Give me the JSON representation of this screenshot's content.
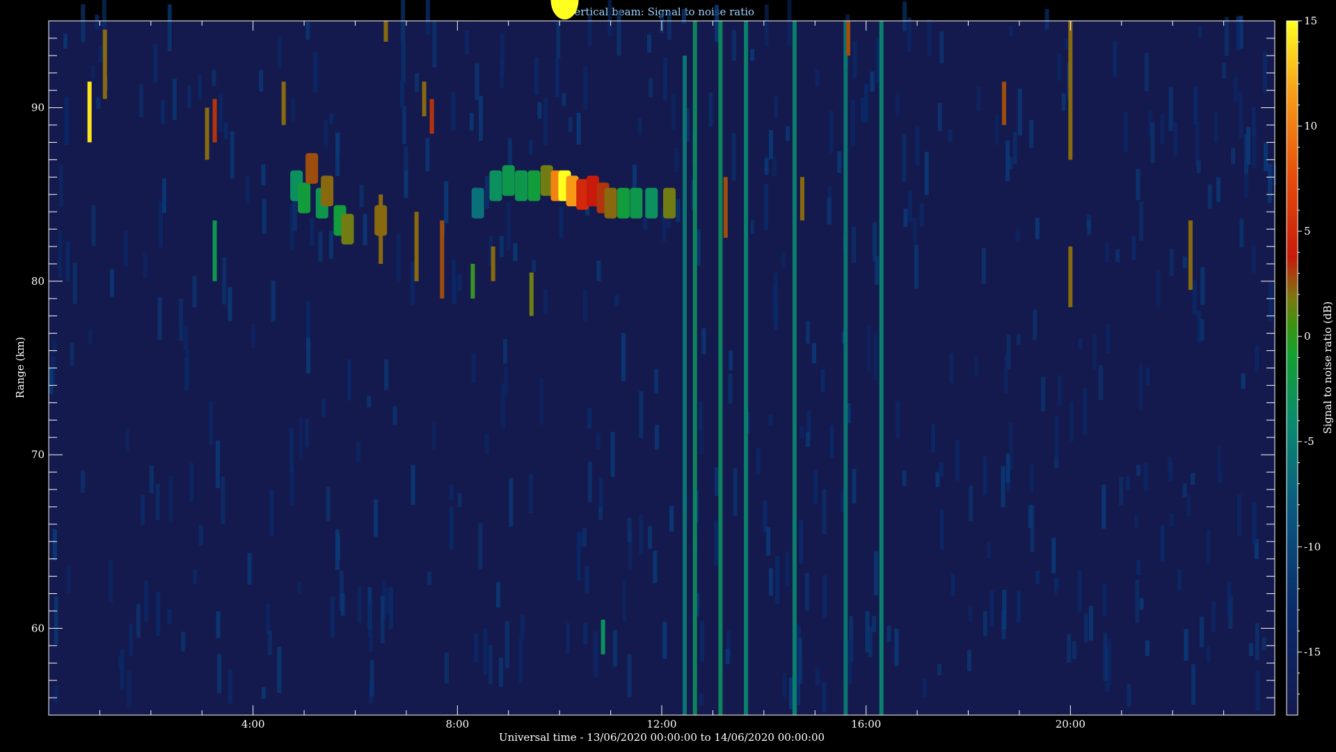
{
  "chart_data": {
    "type": "heatmap",
    "title": "Vertical beam: Signal to noise ratio",
    "xlabel": "Universal time - 13/06/2020 00:00:00 to 14/06/2020 00:00:00",
    "ylabel": "Range (km)",
    "colorbar_label": "Signal to noise ratio (dB)",
    "x_unit": "hours UT",
    "xlim": [
      0,
      24
    ],
    "ylim": [
      55,
      95
    ],
    "x_ticks": [
      {
        "value": 4,
        "label": "4:00"
      },
      {
        "value": 8,
        "label": "8:00"
      },
      {
        "value": 12,
        "label": "12:00"
      },
      {
        "value": 16,
        "label": "16:00"
      },
      {
        "value": 20,
        "label": "20:00"
      }
    ],
    "y_ticks": [
      {
        "value": 60,
        "label": "60"
      },
      {
        "value": 70,
        "label": "70"
      },
      {
        "value": 80,
        "label": "80"
      },
      {
        "value": 90,
        "label": "90"
      }
    ],
    "colorbar_range": [
      -18,
      15
    ],
    "colorbar_ticks": [
      {
        "value": 15,
        "label": "15"
      },
      {
        "value": 10,
        "label": "10"
      },
      {
        "value": 5,
        "label": "5"
      },
      {
        "value": 0,
        "label": "0"
      },
      {
        "value": -5,
        "label": "-5"
      },
      {
        "value": -10,
        "label": "-10"
      },
      {
        "value": -15,
        "label": "-15"
      }
    ],
    "background_snr_db": -16,
    "colormap": [
      "#141a4e",
      "#0a2a6a",
      "#0a5a80",
      "#0a8a70",
      "#14a030",
      "#7a7a10",
      "#c81a0a",
      "#e8500a",
      "#f8a018",
      "#ffff20"
    ],
    "echo_layer": {
      "time_start": 4.8,
      "time_end": 12.2,
      "range_center_km": 85.2,
      "peak": {
        "time": 10.1,
        "range_km": 85.5,
        "snr_db": 15
      },
      "cells": [
        {
          "t": 4.85,
          "r": 85.5,
          "snr": -6
        },
        {
          "t": 5.0,
          "r": 84.8,
          "snr": -4
        },
        {
          "t": 5.15,
          "r": 86.5,
          "snr": 2
        },
        {
          "t": 5.35,
          "r": 84.5,
          "snr": -5
        },
        {
          "t": 5.45,
          "r": 85.2,
          "snr": 1
        },
        {
          "t": 5.7,
          "r": 83.5,
          "snr": -4
        },
        {
          "t": 5.85,
          "r": 83.0,
          "snr": 0
        },
        {
          "t": 6.5,
          "r": 83.5,
          "snr": 1
        },
        {
          "t": 8.4,
          "r": 84.5,
          "snr": -9
        },
        {
          "t": 8.75,
          "r": 85.5,
          "snr": -6
        },
        {
          "t": 9.0,
          "r": 85.8,
          "snr": -5
        },
        {
          "t": 9.25,
          "r": 85.5,
          "snr": -5
        },
        {
          "t": 9.5,
          "r": 85.5,
          "snr": -4
        },
        {
          "t": 9.75,
          "r": 85.8,
          "snr": 0
        },
        {
          "t": 9.95,
          "r": 85.5,
          "snr": 10
        },
        {
          "t": 10.1,
          "r": 85.5,
          "snr": 15
        },
        {
          "t": 10.25,
          "r": 85.2,
          "snr": 11
        },
        {
          "t": 10.45,
          "r": 85.0,
          "snr": 5
        },
        {
          "t": 10.65,
          "r": 85.2,
          "snr": 4
        },
        {
          "t": 10.85,
          "r": 84.8,
          "snr": 3
        },
        {
          "t": 11.0,
          "r": 84.5,
          "snr": 1
        },
        {
          "t": 11.25,
          "r": 84.5,
          "snr": -4
        },
        {
          "t": 11.5,
          "r": 84.5,
          "snr": -5
        },
        {
          "t": 11.8,
          "r": 84.5,
          "snr": -6
        },
        {
          "t": 12.15,
          "r": 84.5,
          "snr": 0
        }
      ]
    },
    "vertical_streaks": [
      {
        "t": 12.45,
        "r_min": 55,
        "r_max": 93,
        "snr": -8
      },
      {
        "t": 12.65,
        "r_min": 55,
        "r_max": 95,
        "snr": -6
      },
      {
        "t": 13.15,
        "r_min": 55,
        "r_max": 95,
        "snr": -6
      },
      {
        "t": 13.65,
        "r_min": 55,
        "r_max": 95,
        "snr": -7
      },
      {
        "t": 14.6,
        "r_min": 55,
        "r_max": 95,
        "snr": -7
      },
      {
        "t": 15.6,
        "r_min": 55,
        "r_max": 95,
        "snr": -8
      },
      {
        "t": 16.3,
        "r_min": 55,
        "r_max": 95,
        "snr": -7
      }
    ],
    "meteor_blips": [
      {
        "t": 0.8,
        "r_min": 88,
        "r_max": 91.5,
        "snr": 14
      },
      {
        "t": 1.1,
        "r_min": 90.5,
        "r_max": 94.5,
        "snr": 1
      },
      {
        "t": 3.1,
        "r_min": 87,
        "r_max": 90,
        "snr": 1
      },
      {
        "t": 3.25,
        "r_min": 88,
        "r_max": 90.5,
        "snr": 3
      },
      {
        "t": 3.25,
        "r_min": 80,
        "r_max": 83.5,
        "snr": -5
      },
      {
        "t": 4.6,
        "r_min": 89,
        "r_max": 91.5,
        "snr": 1
      },
      {
        "t": 6.6,
        "r_min": 93.8,
        "r_max": 95,
        "snr": 1
      },
      {
        "t": 6.5,
        "r_min": 81,
        "r_max": 85,
        "snr": 1
      },
      {
        "t": 7.35,
        "r_min": 89.5,
        "r_max": 91.5,
        "snr": 1
      },
      {
        "t": 7.5,
        "r_min": 88.5,
        "r_max": 90.5,
        "snr": 3
      },
      {
        "t": 7.2,
        "r_min": 80,
        "r_max": 84,
        "snr": 1
      },
      {
        "t": 7.7,
        "r_min": 79,
        "r_max": 83.5,
        "snr": 2
      },
      {
        "t": 8.3,
        "r_min": 79,
        "r_max": 81,
        "snr": -2
      },
      {
        "t": 8.7,
        "r_min": 80,
        "r_max": 82,
        "snr": 1
      },
      {
        "t": 9.45,
        "r_min": 78,
        "r_max": 80.5,
        "snr": 0
      },
      {
        "t": 10.85,
        "r_min": 58.5,
        "r_max": 60.5,
        "snr": -6
      },
      {
        "t": 13.25,
        "r_min": 82.5,
        "r_max": 86,
        "snr": 2
      },
      {
        "t": 14.75,
        "r_min": 83.5,
        "r_max": 86,
        "snr": 1
      },
      {
        "t": 15.65,
        "r_min": 93,
        "r_max": 95,
        "snr": 2
      },
      {
        "t": 18.7,
        "r_min": 89,
        "r_max": 91.5,
        "snr": 2
      },
      {
        "t": 20.0,
        "r_min": 87,
        "r_max": 95,
        "snr": 1
      },
      {
        "t": 20.0,
        "r_min": 78.5,
        "r_max": 82,
        "snr": 1
      },
      {
        "t": 22.35,
        "r_min": 79.5,
        "r_max": 83.5,
        "snr": 1
      }
    ],
    "grid": false,
    "legend": "colorbar-right"
  }
}
